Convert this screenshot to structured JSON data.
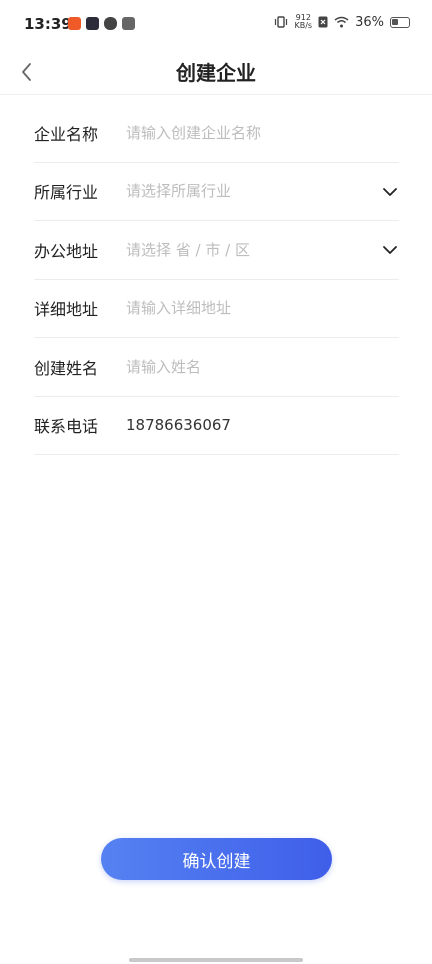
{
  "status_bar": {
    "time": "13:39",
    "net_speed_value": "912",
    "net_speed_unit": "KB/s",
    "battery_percent": "36%",
    "icons": [
      "notification-app-icon",
      "notification-app-icon",
      "notification-app-icon",
      "notification-app-icon",
      "vibrate-icon",
      "wifi-icon",
      "battery-icon"
    ]
  },
  "header": {
    "title": "创建企业",
    "back_icon": "chevron-left-icon"
  },
  "form": {
    "rows": [
      {
        "label": "企业名称",
        "placeholder": "请输入创建企业名称",
        "value": "",
        "has_dropdown": false
      },
      {
        "label": "所属行业",
        "placeholder": "请选择所属行业",
        "value": "",
        "has_dropdown": true
      },
      {
        "label": "办公地址",
        "placeholder": "请选择 省 / 市 / 区",
        "value": "",
        "has_dropdown": true
      },
      {
        "label": "详细地址",
        "placeholder": "请输入详细地址",
        "value": "",
        "has_dropdown": false
      },
      {
        "label": "创建姓名",
        "placeholder": "请输入姓名",
        "value": "",
        "has_dropdown": false
      },
      {
        "label": "联系电话",
        "placeholder": "",
        "value": "18786636067",
        "has_dropdown": false
      }
    ]
  },
  "actions": {
    "confirm_label": "确认创建"
  },
  "colors": {
    "button_gradient_start": "#5582f2",
    "button_gradient_end": "#3f5ee9",
    "placeholder": "#bdbdbd",
    "divider": "#ececec"
  }
}
